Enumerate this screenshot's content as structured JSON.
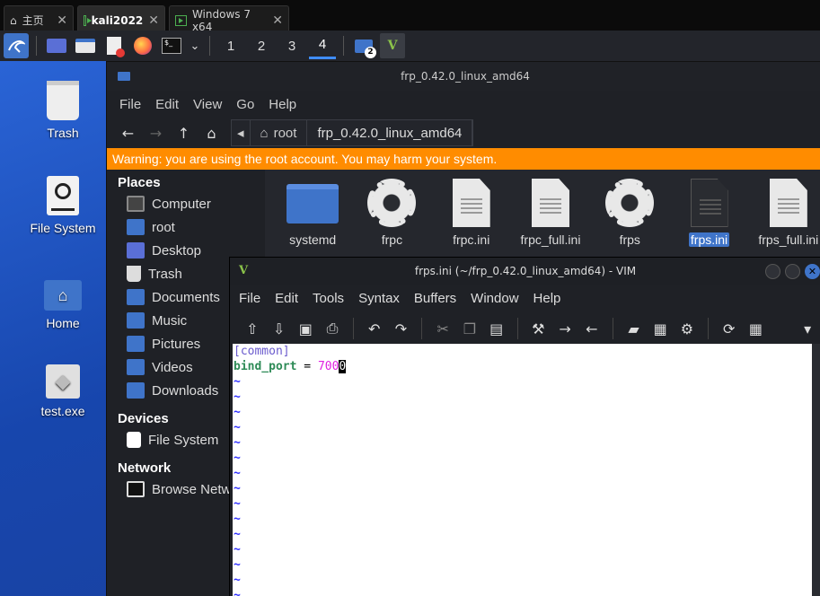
{
  "host_tabs": [
    {
      "label": "主页"
    },
    {
      "label": "kali2022"
    },
    {
      "label": "Windows 7 x64"
    }
  ],
  "panel": {
    "workspaces": [
      "1",
      "2",
      "3",
      "4"
    ],
    "badge": "2"
  },
  "desktop": {
    "icons": [
      {
        "label": "Trash"
      },
      {
        "label": "File System"
      },
      {
        "label": "Home"
      },
      {
        "label": "test.exe"
      }
    ]
  },
  "file_manager": {
    "title": "frp_0.42.0_linux_amd64",
    "menu": [
      "File",
      "Edit",
      "View",
      "Go",
      "Help"
    ],
    "crumbs": [
      "root",
      "frp_0.42.0_linux_amd64"
    ],
    "warning": "Warning: you are using the root account. You may harm your system.",
    "places_heading": "Places",
    "places": [
      "Computer",
      "root",
      "Desktop",
      "Trash",
      "Documents",
      "Music",
      "Pictures",
      "Videos",
      "Downloads"
    ],
    "devices_heading": "Devices",
    "devices": [
      "File System"
    ],
    "network_heading": "Network",
    "network": [
      "Browse Network"
    ],
    "files": [
      "systemd",
      "frpc",
      "frpc.ini",
      "frpc_full.ini",
      "frps",
      "frps.ini",
      "frps_full.ini"
    ]
  },
  "vim": {
    "title": "frps.ini (~/frp_0.42.0_linux_amd64) - VIM",
    "menu": [
      "File",
      "Edit",
      "Tools",
      "Syntax",
      "Buffers",
      "Window",
      "Help"
    ],
    "lines": {
      "section": "[common]",
      "key": "bind_port",
      "eq": " = ",
      "value_prefix": "700",
      "cursor_char": "0"
    },
    "tilde": "~"
  },
  "colors": {
    "accent": "#3f74c9",
    "warning": "#ff8c00",
    "desktop_bg": "#1a4fb5"
  }
}
